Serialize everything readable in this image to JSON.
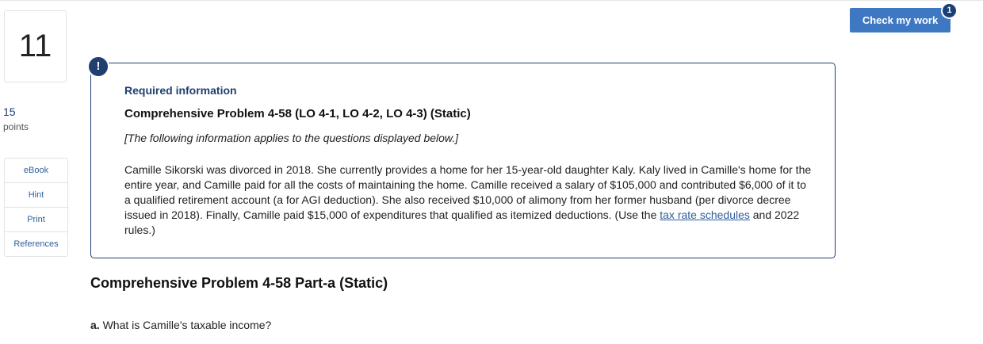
{
  "question": {
    "number": "11",
    "points_value": "15",
    "points_label": "points"
  },
  "side_links": [
    "eBook",
    "Hint",
    "Print",
    "References"
  ],
  "toolbar": {
    "check_label": "Check my work",
    "check_badge": "1"
  },
  "info": {
    "alert_symbol": "!",
    "required_label": "Required information",
    "title": "Comprehensive Problem 4-58 (LO 4-1, LO 4-2, LO 4-3) (Static)",
    "applies_note": "[The following information applies to the questions displayed below.]",
    "body_before_link": "Camille Sikorski was divorced in 2018. She currently provides a home for her 15-year-old daughter Kaly. Kaly lived in Camille's home for the entire year, and Camille paid for all the costs of maintaining the home. Camille received a salary of $105,000 and contributed $6,000 of it to a qualified retirement account (a for AGI deduction). She also received $10,000 of alimony from her former husband (per divorce decree issued in 2018). Finally, Camille paid $15,000 of expenditures that qualified as itemized deductions. (Use the ",
    "body_link": "tax rate schedules",
    "body_after_link": " and 2022 rules.)"
  },
  "part": {
    "heading": "Comprehensive Problem 4-58 Part-a (Static)",
    "question_prefix": "a.",
    "question_text": " What is Camille's taxable income?"
  }
}
